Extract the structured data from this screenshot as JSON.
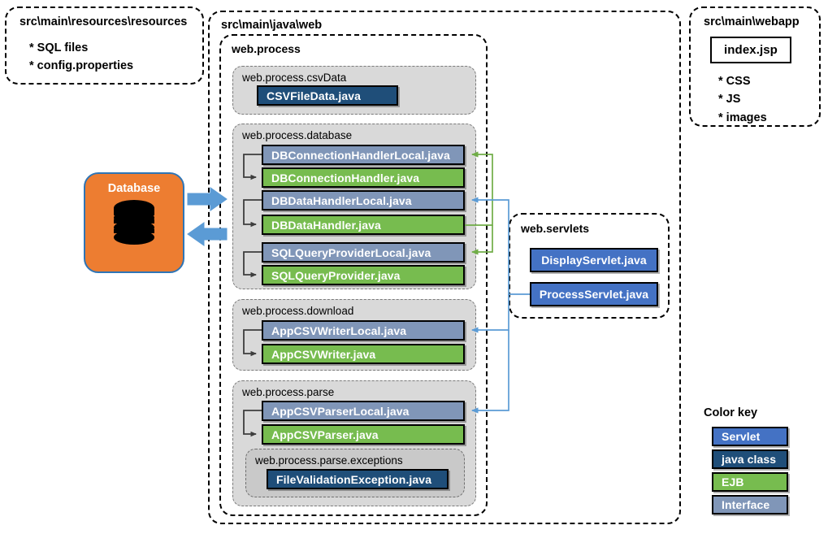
{
  "diagram": {
    "containers": {
      "resources": {
        "title": "src\\main\\resources\\resources",
        "bullets": "* SQL files\n* config.properties"
      },
      "javaweb": {
        "title": "src\\main\\java\\web"
      },
      "webapp": {
        "title": "src\\main\\webapp",
        "file": "index.jsp",
        "bullets": "* CSS\n* JS\n* images"
      },
      "webprocess": {
        "title": "web.process"
      },
      "webservlets": {
        "title": "web.servlets"
      }
    },
    "packages": {
      "csvdata": {
        "title": "web.process.csvData"
      },
      "database": {
        "title": "web.process.database"
      },
      "download": {
        "title": "web.process.download"
      },
      "parse": {
        "title": "web.process.parse"
      },
      "exceptions": {
        "title": "web.process.parse.exceptions"
      }
    },
    "classes": {
      "csvfiledata": "CSVFileData.java",
      "dbconnectionhandlerlocal": "DBConnectionHandlerLocal.java",
      "dbconnectionhandler": "DBConnectionHandler.java",
      "dbdatahandlerlocal": "DBDataHandlerLocal.java",
      "dbdatahandler": "DBDataHandler.java",
      "sqlqueryproviderlocal": "SQLQueryProviderLocal.java",
      "sqlqueryprovider": "SQLQueryProvider.java",
      "appcsvwriterlocal": "AppCSVWriterLocal.java",
      "appcsvwriter": "AppCSVWriter.java",
      "appcsvparserlocal": "AppCSVParserLocal.java",
      "appcsvparser": "AppCSVParser.java",
      "filevalidationexception": "FileValidationException.java",
      "displayservlet": "DisplayServlet.java",
      "processservlet": "ProcessServlet.java"
    },
    "database_node": {
      "label": "Database"
    },
    "color_key": {
      "title": "Color key",
      "items": [
        {
          "label": "Servlet",
          "color": "#4472c4"
        },
        {
          "label": "java class",
          "color": "#1f4e79"
        },
        {
          "label": "EJB",
          "color": "#77bc4f"
        },
        {
          "label": "Interface",
          "color": "#8096b8"
        }
      ]
    },
    "connector_colors": {
      "implements": "#595959",
      "ejb_injection": "#70ad47",
      "servlet_injection": "#5b9bd5",
      "db_arrow": "#5b9bd5"
    }
  }
}
